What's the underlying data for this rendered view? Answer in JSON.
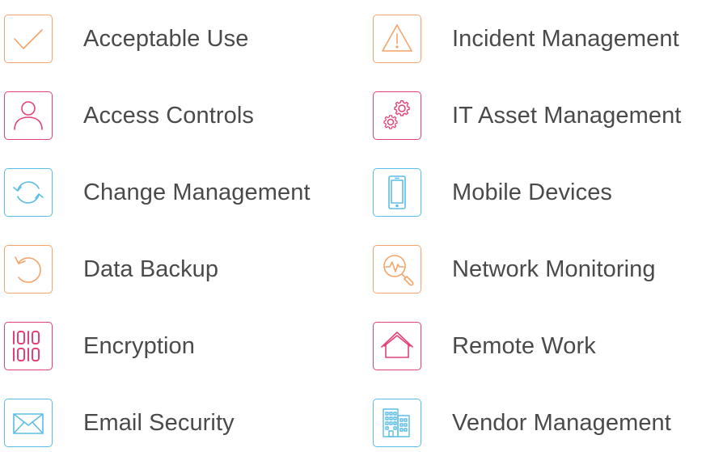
{
  "colors": {
    "orange": "#f4a46a",
    "pink": "#e4407a",
    "blue": "#5bbde6",
    "text": "#4a4a4a"
  },
  "left_column": [
    {
      "label": "Acceptable Use",
      "icon": "checkmark-icon",
      "color": "orange"
    },
    {
      "label": "Access Controls",
      "icon": "user-icon",
      "color": "pink"
    },
    {
      "label": "Change Management",
      "icon": "refresh-icon",
      "color": "blue"
    },
    {
      "label": "Data Backup",
      "icon": "undo-icon",
      "color": "orange"
    },
    {
      "label": "Encryption",
      "icon": "binary-icon",
      "color": "pink"
    },
    {
      "label": "Email Security",
      "icon": "envelope-icon",
      "color": "blue"
    }
  ],
  "right_column": [
    {
      "label": "Incident Management",
      "icon": "warning-icon",
      "color": "orange"
    },
    {
      "label": "IT Asset Management",
      "icon": "gears-icon",
      "color": "pink"
    },
    {
      "label": "Mobile Devices",
      "icon": "phone-icon",
      "color": "blue"
    },
    {
      "label": "Network Monitoring",
      "icon": "monitor-search-icon",
      "color": "orange"
    },
    {
      "label": "Remote Work",
      "icon": "house-icon",
      "color": "pink"
    },
    {
      "label": "Vendor Management",
      "icon": "buildings-icon",
      "color": "blue"
    }
  ]
}
